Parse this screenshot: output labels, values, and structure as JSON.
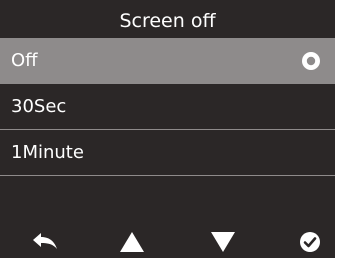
{
  "header": {
    "title": "Screen off"
  },
  "options": [
    {
      "label": "Off",
      "selected": true
    },
    {
      "label": "30Sec",
      "selected": false
    },
    {
      "label": "1Minute",
      "selected": false
    }
  ],
  "toolbar": {
    "icons": [
      "back-arrow-icon",
      "up-triangle-icon",
      "down-triangle-icon",
      "confirm-check-icon"
    ]
  },
  "colors": {
    "background": "#2b2727",
    "selected_row": "#8e8b8b",
    "divider": "#8f8b8b",
    "text": "#ffffff"
  }
}
